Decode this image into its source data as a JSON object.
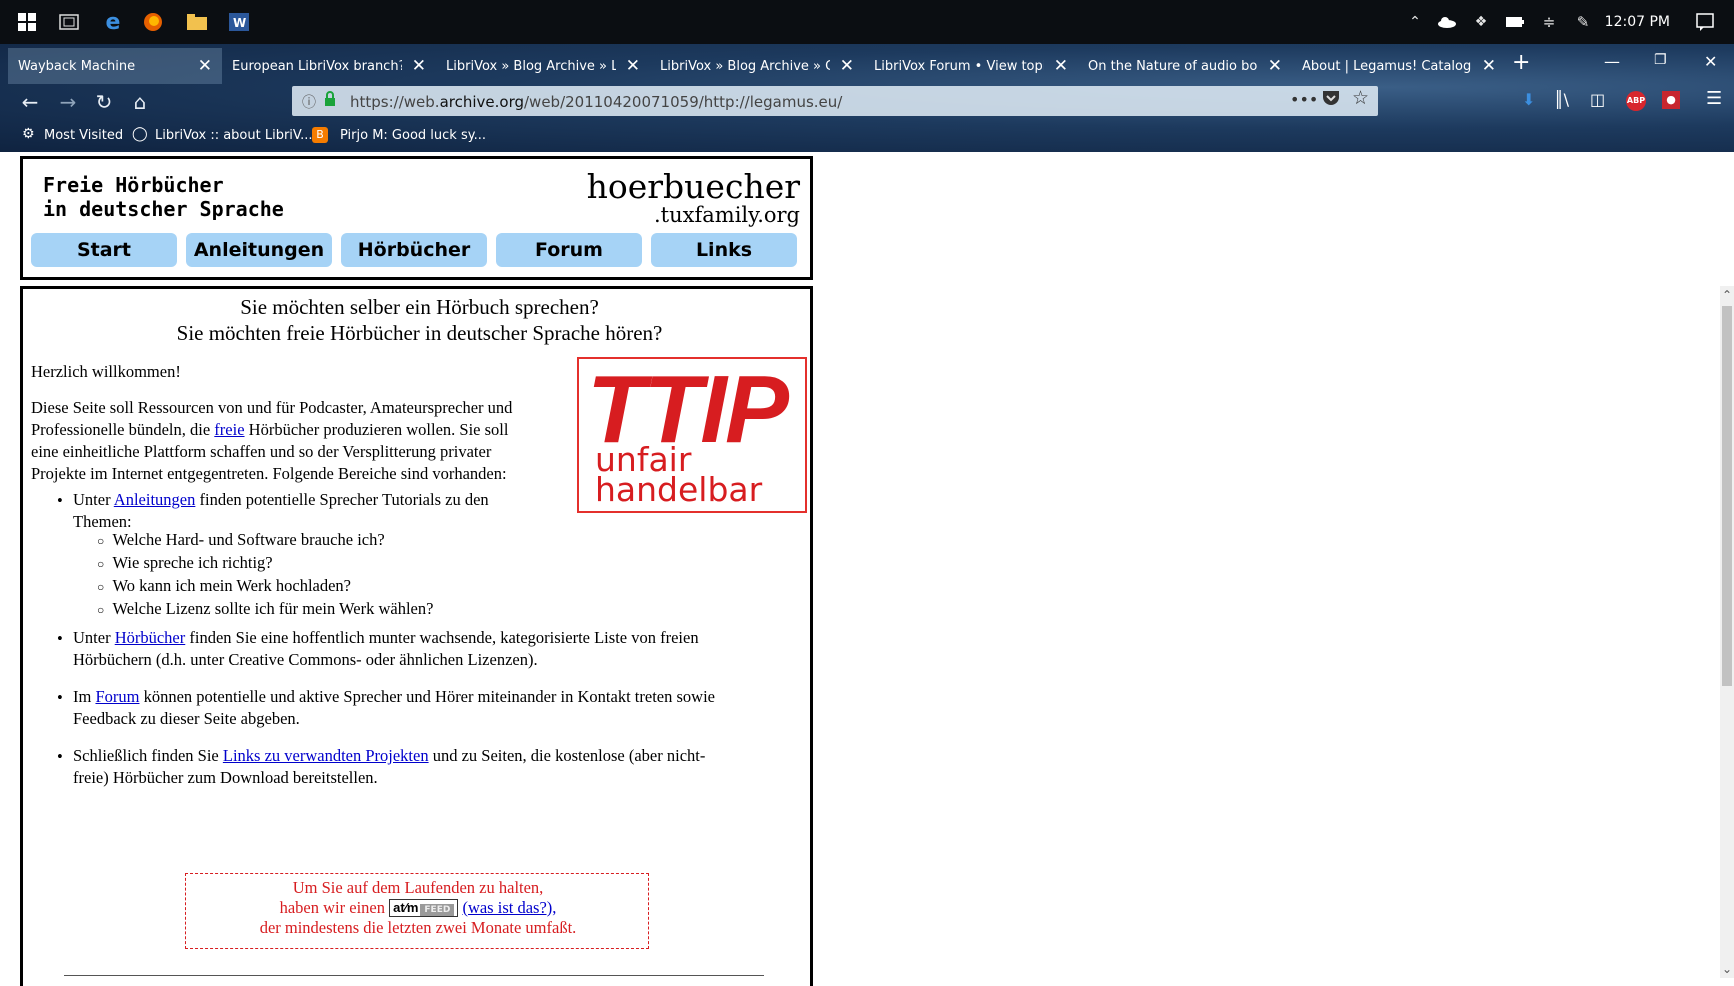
{
  "taskbar": {
    "time": "12:07 PM",
    "apps": [
      "start-icon",
      "task-view-icon",
      "edge-icon",
      "firefox-icon",
      "file-explorer-icon",
      "word-icon"
    ],
    "tray_icons": [
      "chevron-up-icon",
      "onedrive-icon",
      "dropbox-icon",
      "battery-icon",
      "wifi-icon",
      "pen-icon",
      "notification-icon"
    ]
  },
  "browser": {
    "tabs": [
      {
        "label": "Wayback Machine"
      },
      {
        "label": "European LibriVox branch?"
      },
      {
        "label": "LibriVox » Blog Archive » Lil"
      },
      {
        "label": "LibriVox » Blog Archive » Ca"
      },
      {
        "label": "LibriVox Forum • View topic"
      },
      {
        "label": "On the Nature of audio boo"
      },
      {
        "label": "About | Legamus! Catalog"
      }
    ],
    "url_prefix": "https://web.",
    "url_domain": "archive.org",
    "url_rest": "/web/20110420071059/http://legamus.eu/",
    "bookmarks": [
      "Most Visited",
      "LibriVox :: about LibriV...",
      "Pirjo M: Good luck sy..."
    ],
    "addons": [
      "ABP"
    ]
  },
  "site": {
    "title_line1": "Freie Hörbücher",
    "title_line2": "in deutscher Sprache",
    "brand_main": "hoerbuecher",
    "brand_sub": ".tuxfamily.org",
    "menu": [
      "Start",
      "Anleitungen",
      "Hörbücher",
      "Forum",
      "Links"
    ]
  },
  "content": {
    "heading1": "Sie möchten selber ein Hörbuch sprechen?",
    "heading2": "Sie möchten freie Hörbücher in deutscher Sprache hören?",
    "welcome": "Herzlich willkommen!",
    "intro_a": "Diese Seite soll Ressourcen von und für Podcaster, Amateursprecher und",
    "intro_b": "Professionelle bündeln, die ",
    "intro_link": "freie",
    "intro_c": " Hörbücher produzieren wollen. Sie soll",
    "intro_d": "eine einheitliche Plattform schaffen und so der Versplitterung privater",
    "intro_e": "Projekte im Internet entgegentreten. Folgende Bereiche sind vorhanden:",
    "b1_pre": "Unter ",
    "b1_link": "Anleitungen",
    "b1_post": " finden potentielle Sprecher Tutorials zu den",
    "b1_line2": "Themen:",
    "sub_items": [
      "Welche Hard- und Software brauche ich?",
      "Wie spreche ich richtig?",
      "Wo kann ich mein Werk hochladen?",
      "Welche Lizenz sollte ich für mein Werk wählen?"
    ],
    "b2_pre": "Unter ",
    "b2_link": "Hörbücher",
    "b2_post": " finden Sie eine hoffentlich munter wachsende, kategorisierte Liste von freien",
    "b2_line2": "Hörbüchern (d.h. unter Creative Commons- oder ähnlichen Lizenzen).",
    "b3_pre": "Im ",
    "b3_link": "Forum",
    "b3_post": " können potentielle und aktive Sprecher und Hörer miteinander in Kontakt treten sowie",
    "b3_line2": "Feedback zu dieser Seite abgeben.",
    "b4_pre": "Schließlich finden Sie ",
    "b4_link": "Links zu verwandten Projekten",
    "b4_post": " und zu Seiten, die kostenlose (aber nicht-",
    "b4_line2": "freie) Hörbücher zum Download bereitstellen.",
    "ttip_big": "TTIP",
    "ttip_line1": "unfair",
    "ttip_line2": "handelbar",
    "feed_line1": "Um Sie auf dem Laufenden zu halten,",
    "feed_line2_pre": "haben wir einen",
    "feed_badge": "at⁄m",
    "feed_badge_small": "FEED",
    "feed_link": "(was ist das?),",
    "feed_line3": "der mindestens die letzten zwei Monate umfaßt."
  },
  "colors": {
    "menu_button": "#a6d3f6",
    "ttip_red": "#d71d20",
    "link": "#0000cc"
  }
}
